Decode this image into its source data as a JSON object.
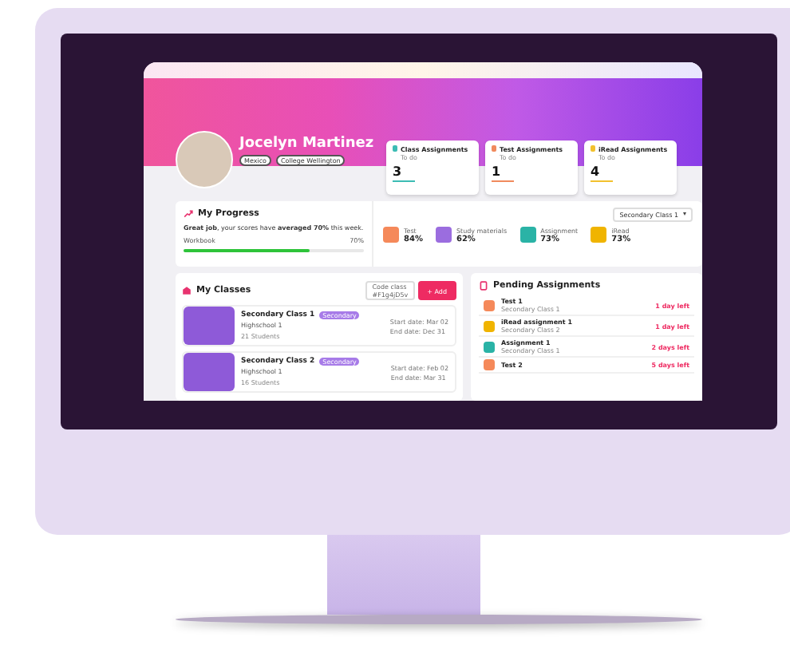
{
  "profile": {
    "name": "Jocelyn Martinez",
    "tags": [
      "Mexico",
      "College Wellington"
    ]
  },
  "stat_cards": [
    {
      "title": "Class Assignments",
      "subtitle": "To do",
      "count": "3",
      "color": "#3cbcb4"
    },
    {
      "title": "Test Assignments",
      "subtitle": "To do",
      "count": "1",
      "color": "#f08a5d"
    },
    {
      "title": "iRead Assignments",
      "subtitle": "To do",
      "count": "4",
      "color": "#f2c12e"
    }
  ],
  "progress": {
    "title": "My Progress",
    "message": "**Great job**, your scores have **averaged 70%** this week.",
    "bar_label": "Workbook",
    "bar_reading": "70%",
    "level": 0.7,
    "class_select": "Secondary Class 1",
    "metrics": [
      {
        "label": "Test",
        "value": "84%",
        "color": "#f5895a"
      },
      {
        "label": "Study materials",
        "value": "62%",
        "color": "#9b6ddf"
      },
      {
        "label": "Assignment",
        "value": "73%",
        "color": "#2ab3a6"
      },
      {
        "label": "iRead",
        "value": "73%",
        "color": "#f0b400"
      }
    ]
  },
  "classes": {
    "title": "My Classes",
    "code_field": {
      "label": "Code class",
      "value": "#F1g4jD5v"
    },
    "add_button": "+ Add",
    "rows": [
      {
        "name": "Secondary Class 1",
        "badge": "Secondary",
        "school": "Highschool 1",
        "students": "21 Students",
        "start": "Start date: Mar 02",
        "end": "End date: Dec 31"
      },
      {
        "name": "Secondary Class 2",
        "badge": "Secondary",
        "school": "Highschool 1",
        "students": "16 Students",
        "start": "Start date: Feb 02",
        "end": "End date: Mar 31"
      }
    ]
  },
  "pending": {
    "title": "Pending Assignments",
    "items": [
      {
        "title": "Test 1",
        "subtitle": "Secondary Class 1",
        "due": "1 day left",
        "color": "#f5895a"
      },
      {
        "title": "iRead assignment 1",
        "subtitle": "Secondary Class 2",
        "due": "1 day left",
        "color": "#f0b400"
      },
      {
        "title": "Assignment 1",
        "subtitle": "Secondary Class 1",
        "due": "2 days left",
        "color": "#2ab3a6"
      },
      {
        "title": "Test 2",
        "due": "5 days left",
        "color": "#f5895a"
      }
    ]
  }
}
